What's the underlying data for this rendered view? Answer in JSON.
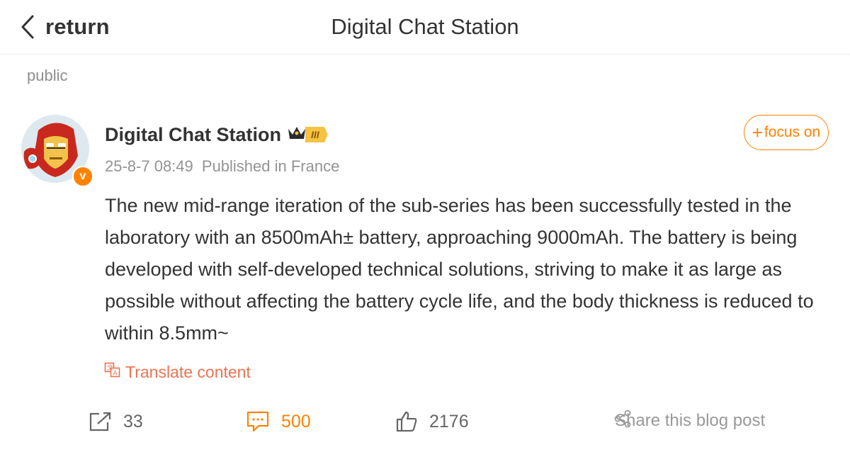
{
  "header": {
    "back_label": "return",
    "title": "Digital Chat Station"
  },
  "post": {
    "visibility": "public",
    "author": {
      "name": "Digital Chat Station",
      "vip_level": "III",
      "verified": "v"
    },
    "timestamp": "25-8-7 08:49",
    "location": "Published in France",
    "follow_label": "focus on",
    "follow_plus": "+",
    "text": "The new mid-range iteration of the sub-series has been successfully tested in the laboratory with an 8500mAh± battery, approaching 9000mAh. The battery is being developed with self-developed technical solutions, striving to make it as large as possible without affecting the battery cycle life, and the body thickness is reduced to within 8.5mm~",
    "translate_label": "Translate content"
  },
  "actions": {
    "reposts": "33",
    "comments": "500",
    "likes": "2176",
    "share_label": "Share this blog post"
  },
  "icons": {
    "back": "chevron-left-icon",
    "crown": "crown-icon",
    "translate": "translate-icon",
    "repost": "repost-icon",
    "comment": "comment-icon",
    "like": "thumbs-up-icon",
    "share": "share-icon"
  },
  "colors": {
    "accent": "#ff8200",
    "translate": "#eb7350",
    "text": "#333333",
    "muted": "#939393"
  }
}
